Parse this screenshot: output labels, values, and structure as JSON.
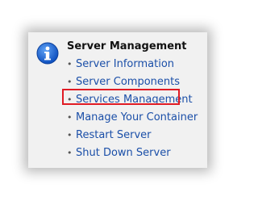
{
  "panel": {
    "title": "Server Management",
    "items": [
      {
        "label": "Server Information"
      },
      {
        "label": "Server Components"
      },
      {
        "label": "Services Management"
      },
      {
        "label": "Manage Your Container"
      },
      {
        "label": "Restart Server"
      },
      {
        "label": "Shut Down Server"
      }
    ],
    "icon": "info-icon"
  },
  "colors": {
    "link": "#1b4fa8",
    "highlight": "#e01b24",
    "icon_blue": "#1a66d6",
    "panel_bg": "#f1f1f1"
  }
}
